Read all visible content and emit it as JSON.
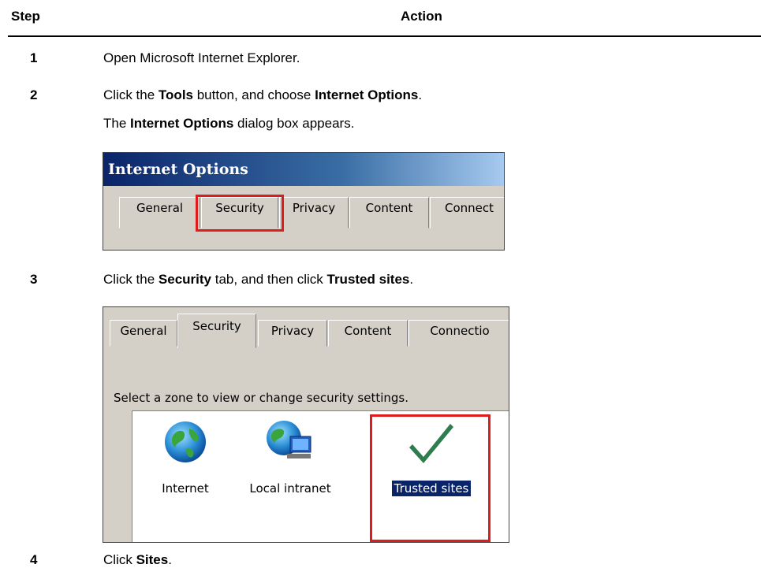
{
  "header": {
    "step_label": "Step",
    "action_label": "Action"
  },
  "steps": [
    {
      "num": "1",
      "line1": [
        {
          "t": "Open Microsoft Internet Explorer.",
          "b": false
        }
      ]
    },
    {
      "num": "2",
      "line1": [
        {
          "t": "Click the ",
          "b": false
        },
        {
          "t": "Tools",
          "b": true
        },
        {
          "t": " button, and choose ",
          "b": false
        },
        {
          "t": "Internet Options",
          "b": true
        },
        {
          "t": ".",
          "b": false
        }
      ],
      "line2": [
        {
          "t": "The ",
          "b": false
        },
        {
          "t": "Internet Options",
          "b": true
        },
        {
          "t": " dialog box appears.",
          "b": false
        }
      ]
    },
    {
      "num": "3",
      "line1": [
        {
          "t": "Click the ",
          "b": false
        },
        {
          "t": "Security",
          "b": true
        },
        {
          "t": " tab, and then click ",
          "b": false
        },
        {
          "t": "Trusted sites",
          "b": true
        },
        {
          "t": ".",
          "b": false
        }
      ]
    },
    {
      "num": "4",
      "line1": [
        {
          "t": "Click ",
          "b": false
        },
        {
          "t": "Sites",
          "b": true
        },
        {
          "t": ".",
          "b": false
        }
      ]
    }
  ],
  "shot1": {
    "title": "Internet Options",
    "tabs": [
      "General",
      "Security",
      "Privacy",
      "Content",
      "Connect"
    ]
  },
  "shot2": {
    "tabs": [
      "General",
      "Security",
      "Privacy",
      "Content",
      "Connectio"
    ],
    "zone_prompt": "Select a zone to view or change security settings.",
    "zones": [
      {
        "label": "Internet",
        "icon": "globe-icon"
      },
      {
        "label": "Local intranet",
        "icon": "network-globe-icon"
      },
      {
        "label": "Trusted sites",
        "icon": "checkmark-icon",
        "selected": true
      }
    ]
  },
  "colors": {
    "highlight": "#e01b1b",
    "titlebar": "#0a246a",
    "dialog": "#d4d0c8",
    "checkmark": "#2e7d4f"
  }
}
